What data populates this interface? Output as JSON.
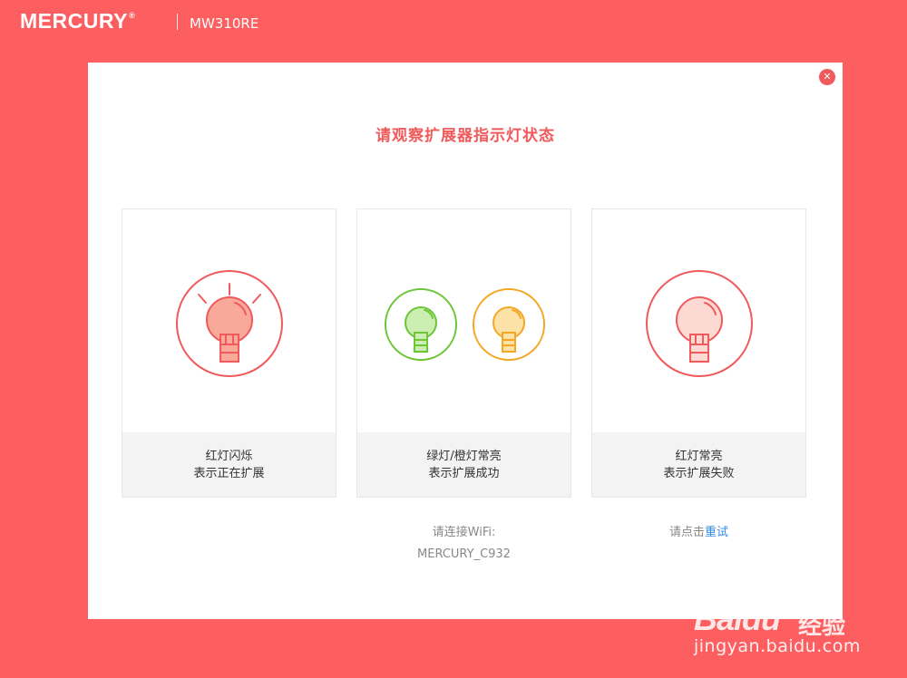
{
  "header": {
    "brand": "MERCURY",
    "brand_mark": "®",
    "model": "MW310RE"
  },
  "dialog": {
    "title": "请观察扩展器指示灯状态",
    "close_icon": "close-icon",
    "cards": [
      {
        "line1": "红灯闪烁",
        "line2": "表示正在扩展",
        "icon": "bulb-blinking-icon",
        "color": "#f05a5c"
      },
      {
        "line1": "绿灯/橙灯常亮",
        "line2": "表示扩展成功",
        "icons": [
          "bulb-green-icon",
          "bulb-orange-icon"
        ],
        "colors": [
          "#6cc636",
          "#f5a623"
        ]
      },
      {
        "line1": "红灯常亮",
        "line2": "表示扩展失败",
        "icon": "bulb-red-icon",
        "color": "#f05a5c"
      }
    ],
    "wifi_note": {
      "label": "请连接WiFi:",
      "ssid": "MERCURY_C932"
    },
    "retry_note": {
      "prefix": "请点击",
      "link": "重试"
    }
  },
  "watermark": {
    "brand": "Bai",
    "brand_end": "du",
    "product": "经验",
    "url": "jingyan.baidu.com"
  },
  "colors": {
    "background": "#fd5e60",
    "accent": "#f05a5c",
    "link": "#2e8ae6",
    "green": "#6cc636",
    "orange": "#f5a623"
  }
}
